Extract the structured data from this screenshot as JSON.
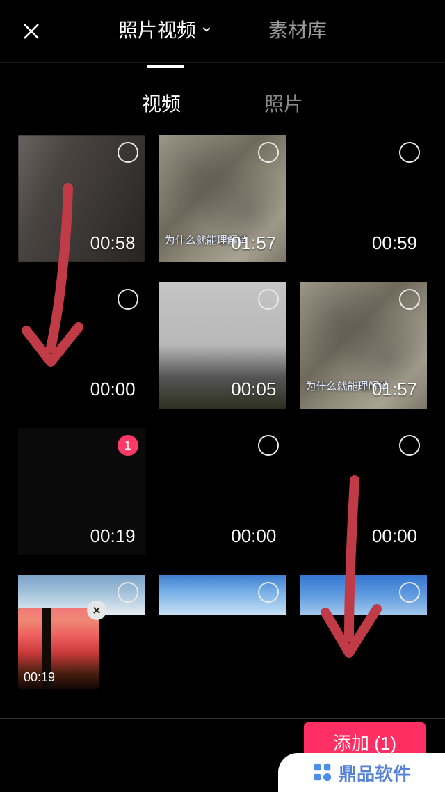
{
  "header": {
    "tabs": [
      "照片视频",
      "素材库"
    ],
    "activeTab": 0
  },
  "sub_tabs": {
    "items": [
      "视频",
      "照片"
    ],
    "active": 0
  },
  "videos": [
    {
      "duration": "00:58",
      "selected": false,
      "style": "blur"
    },
    {
      "duration": "01:57",
      "selected": false,
      "style": "rocky",
      "overlay_text": "为什么就能理解单"
    },
    {
      "duration": "00:59",
      "selected": false,
      "style": "black"
    },
    {
      "duration": "00:00",
      "selected": false,
      "style": "black"
    },
    {
      "duration": "00:05",
      "selected": false,
      "style": "foggy"
    },
    {
      "duration": "01:57",
      "selected": false,
      "style": "rocky",
      "overlay_text": "为什么就能理解单"
    },
    {
      "duration": "00:19",
      "selected": true,
      "sel_index": "1",
      "style": "sunset"
    },
    {
      "duration": "00:00",
      "selected": false,
      "style": "black"
    },
    {
      "duration": "00:00",
      "selected": false,
      "style": "black"
    },
    {
      "duration": "",
      "selected": false,
      "style": "sky1",
      "short": true
    },
    {
      "duration": "",
      "selected": false,
      "style": "sky2",
      "short": true
    },
    {
      "duration": "",
      "selected": false,
      "style": "sky3",
      "short": true
    }
  ],
  "tray": [
    {
      "duration": "00:19",
      "style": "sunset"
    }
  ],
  "add_button": {
    "label": "添加 (1)"
  },
  "watermark": {
    "text": "鼎品软件"
  }
}
